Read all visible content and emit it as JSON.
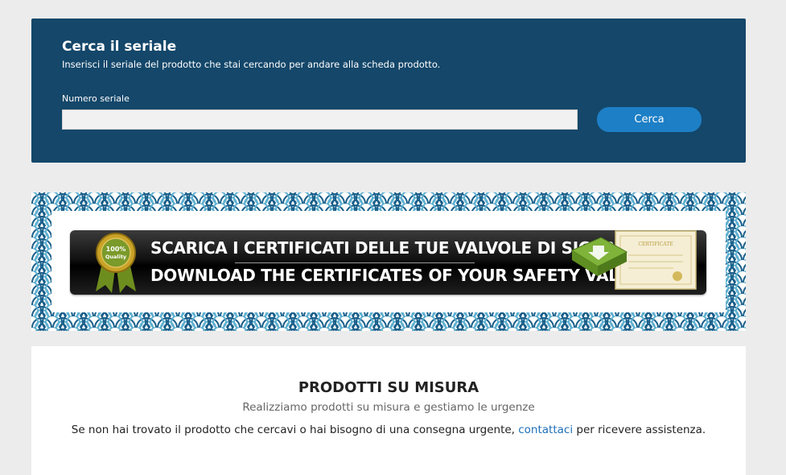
{
  "search": {
    "title": "Cerca il seriale",
    "description": "Inserisci il seriale del prodotto che stai cercando per andare alla scheda prodotto.",
    "field_label": "Numero seriale",
    "field_value": "",
    "button_label": "Cerca"
  },
  "banner": {
    "line1": "SCARICA I CERTIFICATI DELLE TUE VALVOLE DI SICUREZZA",
    "line2": "DOWNLOAD THE CERTIFICATES OF YOUR SAFETY VALVES",
    "medal_text_1": "100%",
    "medal_text_2": "Quality",
    "certificate_text": "CERTIFICATE",
    "pattern_colors": [
      "#1a5f8a",
      "#5fb0d0",
      "#ffffff"
    ]
  },
  "info": {
    "title": "PRODOTTI SU MISURA",
    "subtitle": "Realizziamo prodotti su misura e gestiamo le urgenze",
    "body_before": "Se non hai trovato il prodotto che cercavi o hai bisogno di una consegna urgente, ",
    "link_text": "contattaci",
    "body_after": " per ricevere assistenza."
  }
}
